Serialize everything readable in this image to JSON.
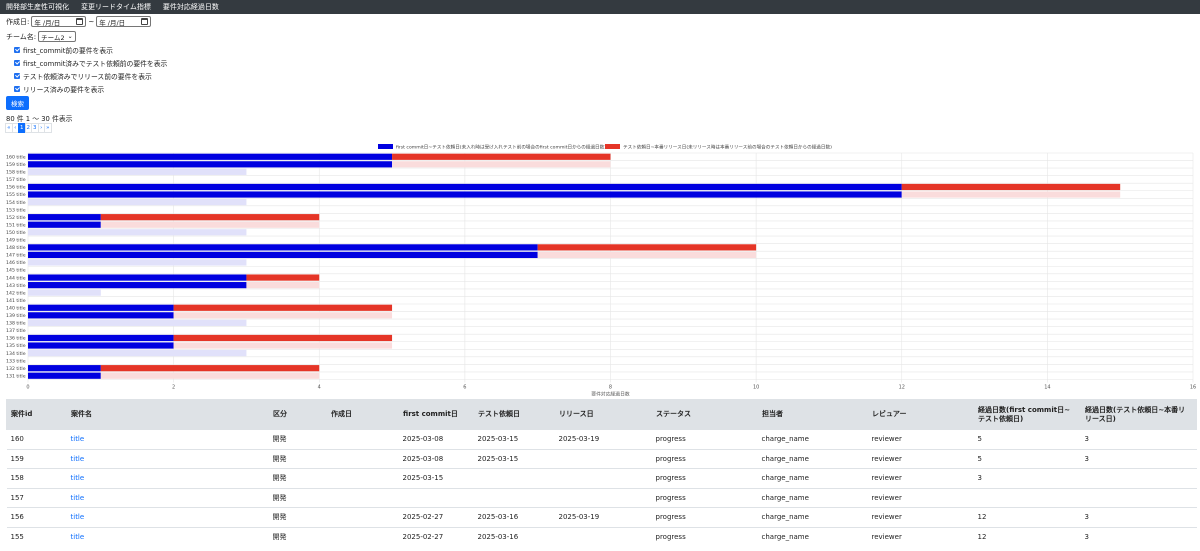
{
  "nav": {
    "items": [
      "開発部生産性可視化",
      "変更リードタイム指標",
      "要件対応経過日数"
    ]
  },
  "form": {
    "created_label": "作成日:",
    "date_from_placeholder": "年 /月/日",
    "date_tilde": "~",
    "date_to_placeholder": "年 /月/日",
    "team_label": "チーム名:",
    "team_selected": "チーム2",
    "checkboxes": [
      "first_commit前の要件を表示",
      "first_commit済みでテスト依頼前の要件を表示",
      "テスト依頼済みでリリース前の要件を表示",
      "リリース済みの要件を表示"
    ],
    "search_label": "検索"
  },
  "result_count": "80 件 1 〜 30 件表示",
  "pagination": {
    "items": [
      "«",
      "‹",
      "1",
      "2",
      "3",
      "›",
      "»"
    ],
    "active": "1"
  },
  "colors": {
    "blue": "#0000e0",
    "red": "#e53527",
    "pink": "#fadcdc",
    "lavender": "#e1e1fa",
    "grid": "#e6e6e6"
  },
  "chart_data": {
    "type": "bar",
    "orientation": "horizontal",
    "stacked": true,
    "xlabel": "要件対応経過日数",
    "xlim": [
      0,
      16
    ],
    "xticks": [
      0,
      2,
      4,
      6,
      8,
      10,
      12,
      14,
      16
    ],
    "legend_position": "top-center",
    "legend": [
      "first commit日~テスト依頼日(未入れ時は受け入れテスト前の場合のfirst commit日からの経過日数)",
      "テスト依頼日~本番リリース日(未リリース時は本番リリース前の場合のテスト依頼日からの経過日数)"
    ],
    "categories": [
      "160 title",
      "159 title",
      "158 title",
      "157 title",
      "156 title",
      "155 title",
      "154 title",
      "153 title",
      "152 title",
      "151 title",
      "150 title",
      "149 title",
      "148 title",
      "147 title",
      "146 title",
      "145 title",
      "144 title",
      "143 title",
      "142 title",
      "141 title",
      "140 title",
      "139 title",
      "138 title",
      "137 title",
      "136 title",
      "135 title",
      "134 title",
      "133 title",
      "132 title",
      "131 title"
    ],
    "series": [
      {
        "values": [
          5,
          5,
          0,
          0,
          12,
          12,
          0,
          0,
          1,
          1,
          0,
          0,
          7,
          7,
          0,
          0,
          3,
          3,
          0,
          0,
          2,
          2,
          0,
          0,
          2,
          2,
          0,
          0,
          1,
          1
        ]
      },
      {
        "values": [
          3,
          3,
          3,
          0,
          3,
          3,
          3,
          0,
          3,
          3,
          3,
          0,
          3,
          3,
          3,
          0,
          1,
          1,
          1,
          0,
          3,
          3,
          3,
          0,
          3,
          3,
          3,
          0,
          3,
          3
        ]
      }
    ],
    "series_style": [
      "blue",
      "red",
      "blue",
      "red",
      "blue",
      "red",
      "blue",
      "red",
      "blue",
      "red",
      "blue",
      "red",
      "blue",
      "red",
      "blue",
      "red",
      "blue",
      "red",
      "blue",
      "red",
      "blue",
      "red",
      "blue",
      "red",
      "blue",
      "red",
      "blue",
      "red",
      "blue",
      "red"
    ],
    "row_styles": [
      "solid",
      "solid",
      "faded",
      "none",
      "solid",
      "solid",
      "faded",
      "none",
      "solid",
      "solid",
      "faded",
      "none",
      "solid",
      "solid",
      "faded",
      "none",
      "solid",
      "solid",
      "faded",
      "none",
      "solid",
      "solid",
      "faded",
      "none",
      "solid",
      "solid",
      "faded",
      "none",
      "solid",
      "solid"
    ],
    "row_second_solid": [
      true,
      false,
      false,
      false,
      true,
      false,
      false,
      false,
      true,
      false,
      false,
      false,
      true,
      false,
      false,
      false,
      true,
      false,
      false,
      false,
      true,
      false,
      false,
      false,
      true,
      false,
      false,
      false,
      true,
      false
    ]
  },
  "table": {
    "headers": [
      "案件id",
      "案件名",
      "区分",
      "作成日",
      "first commit日",
      "テスト依頼日",
      "リリース日",
      "ステータス",
      "担当者",
      "レビュアー",
      "経過日数(first commit日~テスト依頼日)",
      "経過日数(テスト依頼日~本番リリース日)"
    ],
    "rows": [
      [
        "160",
        "title",
        "開発",
        "",
        "2025-03-08",
        "2025-03-15",
        "2025-03-19",
        "progress",
        "charge_name",
        "reviewer",
        "5",
        "3"
      ],
      [
        "159",
        "title",
        "開発",
        "",
        "2025-03-08",
        "2025-03-15",
        "",
        "progress",
        "charge_name",
        "reviewer",
        "5",
        "3"
      ],
      [
        "158",
        "title",
        "開発",
        "",
        "2025-03-15",
        "",
        "",
        "progress",
        "charge_name",
        "reviewer",
        "3",
        ""
      ],
      [
        "157",
        "title",
        "開発",
        "",
        "",
        "",
        "",
        "progress",
        "charge_name",
        "reviewer",
        "",
        ""
      ],
      [
        "156",
        "title",
        "開発",
        "",
        "2025-02-27",
        "2025-03-16",
        "2025-03-19",
        "progress",
        "charge_name",
        "reviewer",
        "12",
        "3"
      ],
      [
        "155",
        "title",
        "開発",
        "",
        "2025-02-27",
        "2025-03-16",
        "",
        "progress",
        "charge_name",
        "reviewer",
        "12",
        "3"
      ]
    ]
  }
}
